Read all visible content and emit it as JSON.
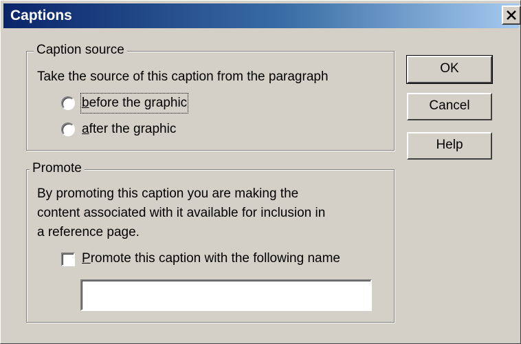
{
  "window": {
    "title": "Captions"
  },
  "caption_source": {
    "legend": "Caption source",
    "instruction": "Take the source of this caption from the paragraph",
    "options": [
      {
        "label_mnemonic": "b",
        "label_rest": "efore the graphic",
        "selected": false
      },
      {
        "label_mnemonic": "a",
        "label_rest": "fter the graphic",
        "selected": false
      }
    ]
  },
  "promote": {
    "legend": "Promote",
    "description_lines": [
      "By promoting this caption you are making the",
      "content associated with it available for inclusion in",
      "a reference page."
    ],
    "checkbox": {
      "label_mnemonic": "P",
      "label_rest": "romote this caption with the following name",
      "checked": false
    },
    "name_value": ""
  },
  "buttons": {
    "ok": "OK",
    "cancel": "Cancel",
    "help": "Help"
  },
  "icons": {
    "close": "close-x-icon"
  },
  "colors": {
    "titlebar_start": "#0a246a",
    "titlebar_end": "#a6caf0",
    "face": "#d4d0c8"
  }
}
